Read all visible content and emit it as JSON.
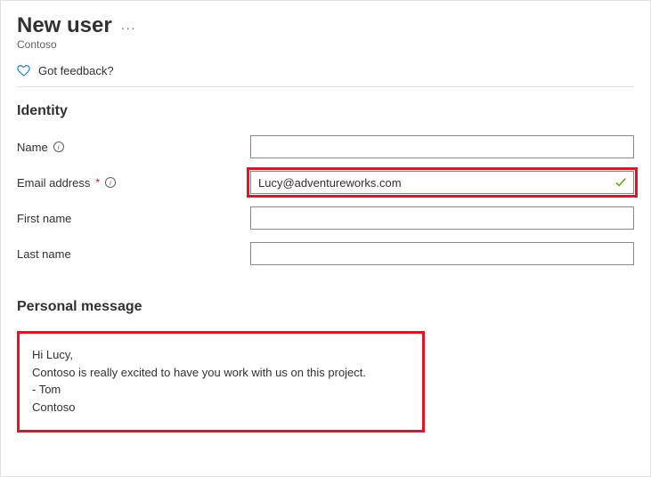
{
  "header": {
    "title": "New user",
    "subtitle": "Contoso",
    "ellipsis": "···"
  },
  "feedback": {
    "label": "Got feedback?"
  },
  "sections": {
    "identity_heading": "Identity",
    "personal_message_heading": "Personal message"
  },
  "form": {
    "name": {
      "label": "Name",
      "value": ""
    },
    "email": {
      "label": "Email address",
      "value": "Lucy@adventureworks.com"
    },
    "first_name": {
      "label": "First name",
      "value": ""
    },
    "last_name": {
      "label": "Last name",
      "value": ""
    }
  },
  "message": {
    "line1": "Hi Lucy,",
    "line2": "Contoso is really excited to have you work with us on this project.",
    "line3": "- Tom",
    "line4": "Contoso"
  },
  "colors": {
    "highlight": "#e81123",
    "accent_blue": "#0078d4",
    "success": "#57a300"
  }
}
